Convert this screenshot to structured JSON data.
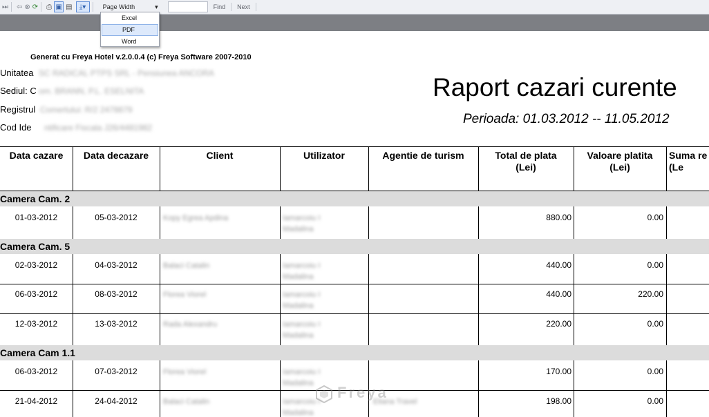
{
  "toolbar": {
    "zoom_value": "Page Width",
    "find_label": "Find",
    "next_label": "Next"
  },
  "export_menu": {
    "items": [
      "Excel",
      "PDF",
      "Word"
    ],
    "highlighted": "PDF"
  },
  "report": {
    "generated_by": "Generat cu Freya Hotel v.2.0.0.4 (c) Freya Software 2007-2010",
    "info_labels": [
      "Unitatea",
      "Sediul: C",
      "Registrul",
      "Cod Ide"
    ],
    "title": "Raport cazari curente",
    "period": "Perioada: 01.03.2012 -- 11.05.2012"
  },
  "table": {
    "headers": [
      "Data cazare",
      "Data decazare",
      "Client",
      "Utilizator",
      "Agentie de turism",
      "Total de plata (Lei)",
      "Valoare platita (Lei)",
      "Suma re (Le"
    ],
    "groups": [
      {
        "name": "Camera Cam. 2",
        "rows": [
          {
            "cazare": "01-03-2012",
            "decazare": "05-03-2012",
            "total": "880.00",
            "platita": "0.00"
          }
        ]
      },
      {
        "name": "Camera Cam. 5",
        "rows": [
          {
            "cazare": "02-03-2012",
            "decazare": "04-03-2012",
            "total": "440.00",
            "platita": "0.00"
          },
          {
            "cazare": "06-03-2012",
            "decazare": "08-03-2012",
            "total": "440.00",
            "platita": "220.00"
          },
          {
            "cazare": "12-03-2012",
            "decazare": "13-03-2012",
            "total": "220.00",
            "platita": "0.00"
          }
        ]
      },
      {
        "name": "Camera Cam 1.1",
        "rows": [
          {
            "cazare": "06-03-2012",
            "decazare": "07-03-2012",
            "total": "170.00",
            "platita": "0.00"
          },
          {
            "cazare": "21-04-2012",
            "decazare": "24-04-2012",
            "total": "198.00",
            "platita": "0.00"
          }
        ]
      }
    ]
  },
  "watermark": "Freya"
}
